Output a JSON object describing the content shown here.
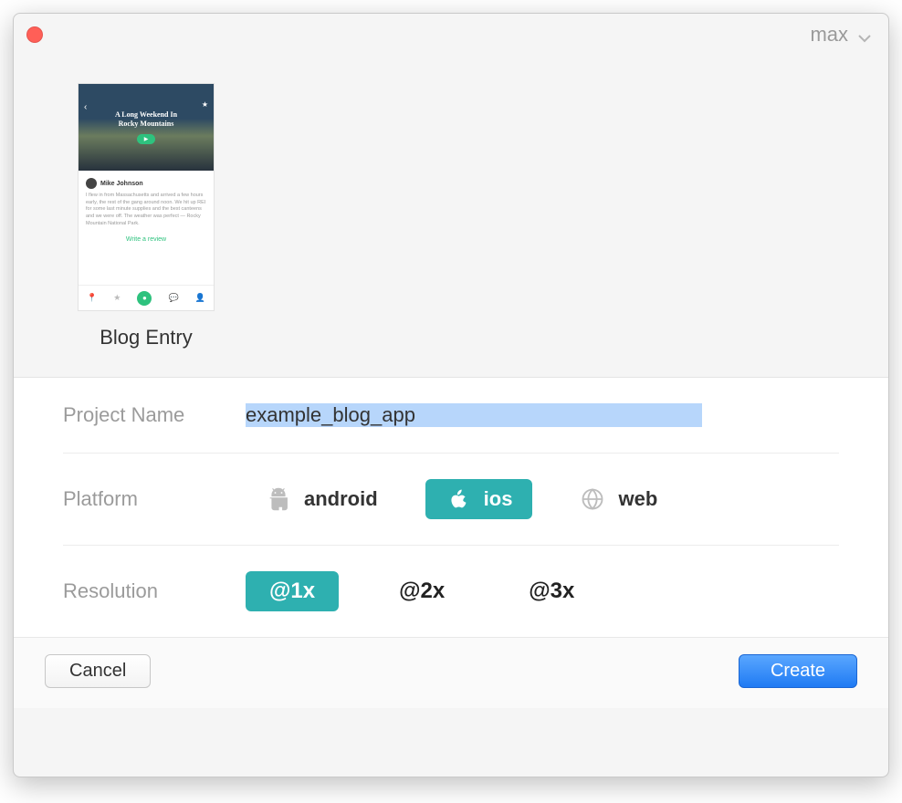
{
  "titlebar": {
    "user_label": "max"
  },
  "preview": {
    "item_label": "Blog Entry",
    "mock": {
      "hero_title_line1": "A Long Weekend In",
      "hero_title_line2": "Rocky Mountains",
      "author": "Mike Johnson",
      "review_cta": "Write a review"
    }
  },
  "form": {
    "project_name_label": "Project Name",
    "project_name_value": "example_blog_app",
    "platform_label": "Platform",
    "platforms": {
      "android": "android",
      "ios": "ios",
      "web": "web",
      "selected": "ios"
    },
    "resolution_label": "Resolution",
    "resolutions": {
      "x1": "@1x",
      "x2": "@2x",
      "x3": "@3x",
      "selected": "@1x"
    }
  },
  "footer": {
    "cancel": "Cancel",
    "create": "Create"
  },
  "colors": {
    "accent": "#2eb0b0",
    "primary_button": "#1f7af3"
  }
}
